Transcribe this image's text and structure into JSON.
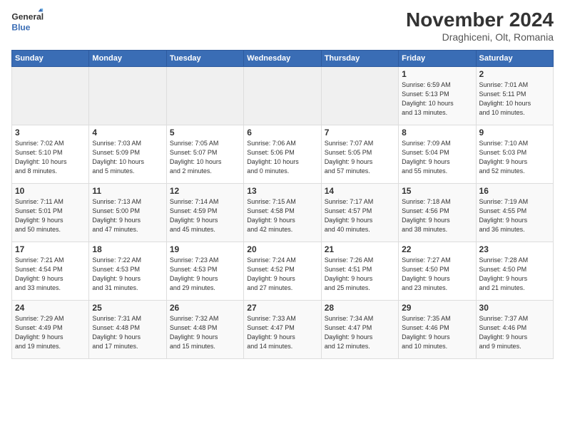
{
  "header": {
    "logo_line1": "General",
    "logo_line2": "Blue",
    "month": "November 2024",
    "location": "Draghiceni, Olt, Romania"
  },
  "weekdays": [
    "Sunday",
    "Monday",
    "Tuesday",
    "Wednesday",
    "Thursday",
    "Friday",
    "Saturday"
  ],
  "weeks": [
    [
      {
        "day": "",
        "info": ""
      },
      {
        "day": "",
        "info": ""
      },
      {
        "day": "",
        "info": ""
      },
      {
        "day": "",
        "info": ""
      },
      {
        "day": "",
        "info": ""
      },
      {
        "day": "1",
        "info": "Sunrise: 6:59 AM\nSunset: 5:13 PM\nDaylight: 10 hours\nand 13 minutes."
      },
      {
        "day": "2",
        "info": "Sunrise: 7:01 AM\nSunset: 5:11 PM\nDaylight: 10 hours\nand 10 minutes."
      }
    ],
    [
      {
        "day": "3",
        "info": "Sunrise: 7:02 AM\nSunset: 5:10 PM\nDaylight: 10 hours\nand 8 minutes."
      },
      {
        "day": "4",
        "info": "Sunrise: 7:03 AM\nSunset: 5:09 PM\nDaylight: 10 hours\nand 5 minutes."
      },
      {
        "day": "5",
        "info": "Sunrise: 7:05 AM\nSunset: 5:07 PM\nDaylight: 10 hours\nand 2 minutes."
      },
      {
        "day": "6",
        "info": "Sunrise: 7:06 AM\nSunset: 5:06 PM\nDaylight: 10 hours\nand 0 minutes."
      },
      {
        "day": "7",
        "info": "Sunrise: 7:07 AM\nSunset: 5:05 PM\nDaylight: 9 hours\nand 57 minutes."
      },
      {
        "day": "8",
        "info": "Sunrise: 7:09 AM\nSunset: 5:04 PM\nDaylight: 9 hours\nand 55 minutes."
      },
      {
        "day": "9",
        "info": "Sunrise: 7:10 AM\nSunset: 5:03 PM\nDaylight: 9 hours\nand 52 minutes."
      }
    ],
    [
      {
        "day": "10",
        "info": "Sunrise: 7:11 AM\nSunset: 5:01 PM\nDaylight: 9 hours\nand 50 minutes."
      },
      {
        "day": "11",
        "info": "Sunrise: 7:13 AM\nSunset: 5:00 PM\nDaylight: 9 hours\nand 47 minutes."
      },
      {
        "day": "12",
        "info": "Sunrise: 7:14 AM\nSunset: 4:59 PM\nDaylight: 9 hours\nand 45 minutes."
      },
      {
        "day": "13",
        "info": "Sunrise: 7:15 AM\nSunset: 4:58 PM\nDaylight: 9 hours\nand 42 minutes."
      },
      {
        "day": "14",
        "info": "Sunrise: 7:17 AM\nSunset: 4:57 PM\nDaylight: 9 hours\nand 40 minutes."
      },
      {
        "day": "15",
        "info": "Sunrise: 7:18 AM\nSunset: 4:56 PM\nDaylight: 9 hours\nand 38 minutes."
      },
      {
        "day": "16",
        "info": "Sunrise: 7:19 AM\nSunset: 4:55 PM\nDaylight: 9 hours\nand 36 minutes."
      }
    ],
    [
      {
        "day": "17",
        "info": "Sunrise: 7:21 AM\nSunset: 4:54 PM\nDaylight: 9 hours\nand 33 minutes."
      },
      {
        "day": "18",
        "info": "Sunrise: 7:22 AM\nSunset: 4:53 PM\nDaylight: 9 hours\nand 31 minutes."
      },
      {
        "day": "19",
        "info": "Sunrise: 7:23 AM\nSunset: 4:53 PM\nDaylight: 9 hours\nand 29 minutes."
      },
      {
        "day": "20",
        "info": "Sunrise: 7:24 AM\nSunset: 4:52 PM\nDaylight: 9 hours\nand 27 minutes."
      },
      {
        "day": "21",
        "info": "Sunrise: 7:26 AM\nSunset: 4:51 PM\nDaylight: 9 hours\nand 25 minutes."
      },
      {
        "day": "22",
        "info": "Sunrise: 7:27 AM\nSunset: 4:50 PM\nDaylight: 9 hours\nand 23 minutes."
      },
      {
        "day": "23",
        "info": "Sunrise: 7:28 AM\nSunset: 4:50 PM\nDaylight: 9 hours\nand 21 minutes."
      }
    ],
    [
      {
        "day": "24",
        "info": "Sunrise: 7:29 AM\nSunset: 4:49 PM\nDaylight: 9 hours\nand 19 minutes."
      },
      {
        "day": "25",
        "info": "Sunrise: 7:31 AM\nSunset: 4:48 PM\nDaylight: 9 hours\nand 17 minutes."
      },
      {
        "day": "26",
        "info": "Sunrise: 7:32 AM\nSunset: 4:48 PM\nDaylight: 9 hours\nand 15 minutes."
      },
      {
        "day": "27",
        "info": "Sunrise: 7:33 AM\nSunset: 4:47 PM\nDaylight: 9 hours\nand 14 minutes."
      },
      {
        "day": "28",
        "info": "Sunrise: 7:34 AM\nSunset: 4:47 PM\nDaylight: 9 hours\nand 12 minutes."
      },
      {
        "day": "29",
        "info": "Sunrise: 7:35 AM\nSunset: 4:46 PM\nDaylight: 9 hours\nand 10 minutes."
      },
      {
        "day": "30",
        "info": "Sunrise: 7:37 AM\nSunset: 4:46 PM\nDaylight: 9 hours\nand 9 minutes."
      }
    ]
  ]
}
